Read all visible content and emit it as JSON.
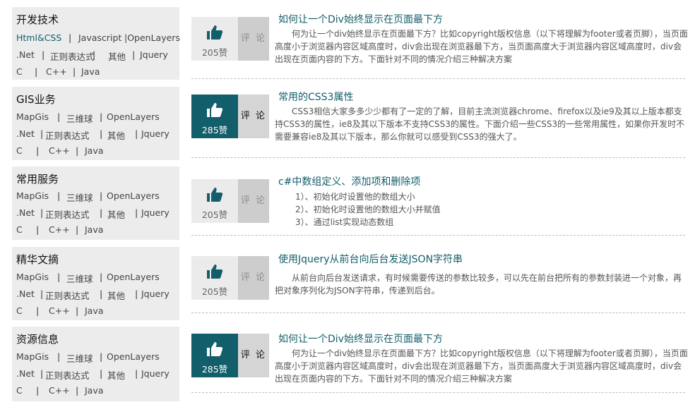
{
  "categories": [
    {
      "title": "开发技术",
      "lines": [
        [
          "Html&CSS",
          "|",
          "Javascript",
          "|OpenLayers"
        ],
        [
          ".Net",
          "|",
          "正则表达式",
          "|",
          "其他",
          "|",
          "Jquery"
        ],
        [
          "C",
          "|",
          "C++",
          "|",
          "Java"
        ]
      ]
    },
    {
      "title": "GIS业务",
      "lines": [
        [
          "MapGis",
          "|",
          "三维球",
          "|",
          "OpenLayers"
        ],
        [
          ".Net",
          "|",
          "正则表达式",
          "|",
          "其他",
          "|",
          "Jquery"
        ],
        [
          "C",
          "|",
          "C++",
          "|",
          "Java"
        ]
      ]
    },
    {
      "title": "常用服务",
      "lines": [
        [
          "MapGis",
          "|",
          "三维球",
          "|",
          "OpenLayers"
        ],
        [
          ".Net",
          "|",
          "正则表达式",
          "|",
          "其他",
          "|",
          "Jquery"
        ],
        [
          "C",
          "|",
          "C++",
          "|",
          "Java"
        ]
      ]
    },
    {
      "title": "精华文摘",
      "lines": [
        [
          "MapGis",
          "|",
          "三维球",
          "|",
          "OpenLayers"
        ],
        [
          ".Net",
          "|",
          "正则表达式",
          "|",
          "其他",
          "|",
          "Jquery"
        ],
        [
          "C",
          "|",
          "C++",
          "|",
          "Java"
        ]
      ]
    },
    {
      "title": "资源信息",
      "lines": [
        [
          "MapGis",
          "|",
          "三维球",
          "|",
          "OpenLayers"
        ],
        [
          ".Net",
          "|",
          "正则表达式",
          "|",
          "其他",
          "|",
          "Jquery"
        ],
        [
          "C",
          "|",
          "C++",
          "|",
          "Java"
        ]
      ]
    }
  ],
  "articles": [
    {
      "title": "如何让一个Div始终显示在页面最下方",
      "likes": "205赞",
      "comment_label": "评 论",
      "highlighted": false,
      "body": "何为让一个div始终显示在页面最下方？比如copyright版权信息（以下将理解为footer或者页脚），当页面高度小于浏览器内容区域高度时，div会出现在浏览器最下方，当页面高度大于浏览器内容区域高度时，div会出现在页面内容的下方。下面针对不同的情况介绍三种解决方案"
    },
    {
      "title": "常用的CSS3属性",
      "likes": "285赞",
      "comment_label": "评 论",
      "highlighted": true,
      "body": "CSS3相信大家多多少少都有了一定的了解，目前主流浏览器chrome、firefox以及ie9及其以上版本都支持CSS3的属性，ie8及其以下版本不支持CSS3的属性。下面介绍一些CSS3的一些常用属性，如果你开发时不需要兼容ie8及其以下版本，那么你就可以感受到CSS3的强大了。"
    },
    {
      "title": "c#中数组定义、添加项和删除项",
      "likes": "205赞",
      "comment_label": "评 论",
      "highlighted": false,
      "list": [
        "1）、初始化时设置他的数组大小",
        "2）、初始化时设置他的数组大小并赋值",
        "3）、通过list实现动态数组"
      ]
    },
    {
      "title": "使用Jquery从前台向后台发送JSON字符串",
      "likes": "205赞",
      "comment_label": "评 论",
      "highlighted": false,
      "body": "从前台向后台发送请求，有时候需要传送的参数比较多，可以先在前台把所有的参数封装进一个对象，再把对象序列化为JSON字符串，传递到后台。"
    },
    {
      "title": "如何让一个Div始终显示在页面最下方",
      "likes": "285赞",
      "comment_label": "评 论",
      "highlighted": true,
      "body": "何为让一个div始终显示在页面最下方？比如copyright版权信息（以下将理解为footer或者页脚），当页面高度小于浏览器内容区域高度时，div会出现在浏览器最下方，当页面高度大于浏览器内容区域高度时，div会出现在页面内容的下方。下面针对不同的情况介绍三种解决方案"
    }
  ],
  "colors": {
    "accent": "#135e6b",
    "panel": "#ececec",
    "link_active": "#0e5f6a"
  },
  "icons": {
    "like": "thumbs-up-icon"
  }
}
